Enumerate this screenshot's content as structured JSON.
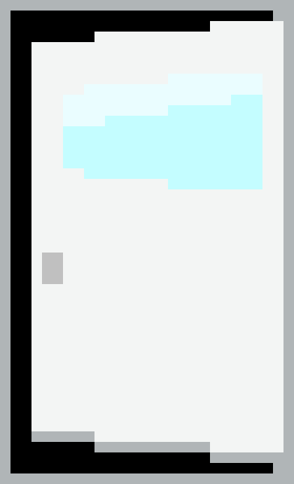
{
  "colors": {
    "frame_outer": "#b0b5b7",
    "frame_inner": "#000000",
    "door": "#f3f5f4",
    "threshold": "#b0b5b7",
    "window": "#c4fdff",
    "window_highlight": "#eafdff",
    "handle": "#c0c0c0"
  },
  "icons": {
    "main": "door-icon",
    "pane": "window-pane-icon",
    "knob": "door-handle-icon"
  }
}
